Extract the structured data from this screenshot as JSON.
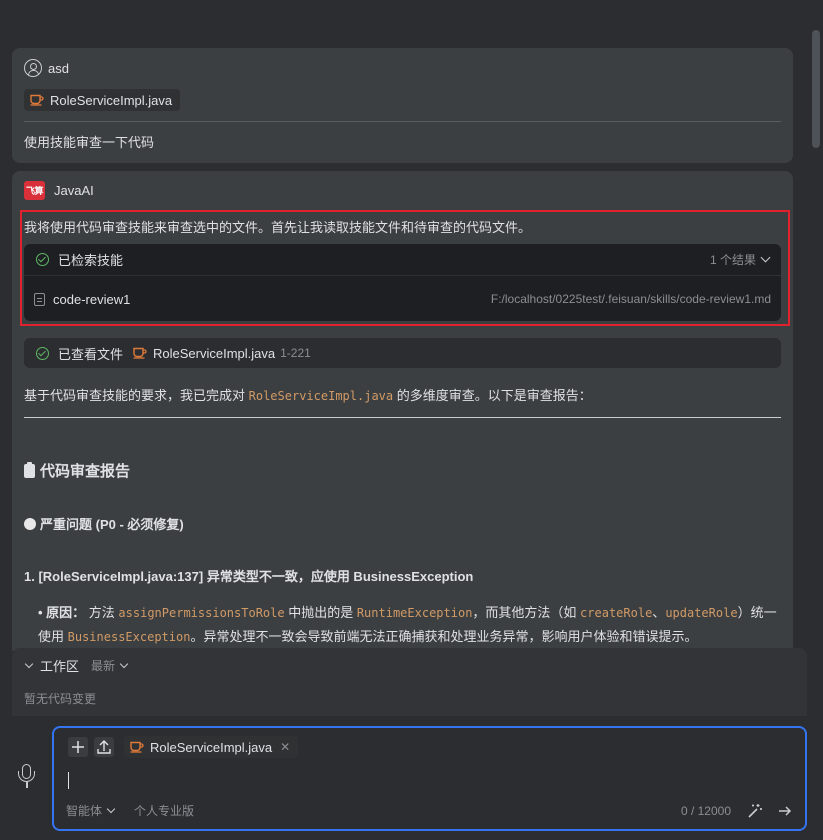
{
  "user_message": {
    "user_name": "asd",
    "attachment": "RoleServiceImpl.java",
    "text": "使用技能审查一下代码"
  },
  "ai_message": {
    "assistant_name": "JavaAI",
    "logo_text": "飞算",
    "intro": "我将使用代码审查技能来审查选中的文件。首先让我读取技能文件和待审查的代码文件。",
    "skill_search": {
      "title": "已检索技能",
      "count": "1 个结果",
      "item_name": "code-review1",
      "item_path": "F:/localhost/0225test/.feisuan/skills/code-review1.md"
    },
    "viewed_file": {
      "label": "已查看文件",
      "file": "RoleServiceImpl.java",
      "range": "1-221"
    },
    "summary": {
      "before": "基于代码审查技能的要求，我已完成对 ",
      "code": "RoleServiceImpl.java",
      "after": " 的多维度审查。以下是审查报告："
    },
    "report_title": "代码审查报告",
    "severity_title": "严重问题 (P0 - 必须修复)",
    "issue_title": "1. [RoleServiceImpl.java:137] 异常类型不一致，应使用 BusinessException",
    "issue": {
      "bullet_label": "原因：",
      "t1": " 方法 ",
      "c1": "assignPermissionsToRole",
      "t2": " 中抛出的是 ",
      "c2": "RuntimeException",
      "t3": "，而其他方法（如 ",
      "c3": "createRole",
      "t4": "、",
      "c4": "updateRole",
      "t5": "）统一使用 ",
      "c5": "BusinessException",
      "t6": "。异常处理不一致会导致前端无法正确捕获和处理业务异常，影响用户体验和错误提示。"
    }
  },
  "workspace": {
    "title": "工作区",
    "sort": "最新",
    "empty_text": "暂无代码变更"
  },
  "input": {
    "attachment": "RoleServiceImpl.java",
    "value": "",
    "mode": "智能体",
    "plan": "个人专业版",
    "counter": "0 / 12000"
  },
  "colors": {
    "background": "#2b2d30",
    "card": "#3c3f41",
    "accent": "#3574f0",
    "highlight_border": "#e0212e",
    "success": "#5fb865",
    "code": "#d19a66"
  }
}
